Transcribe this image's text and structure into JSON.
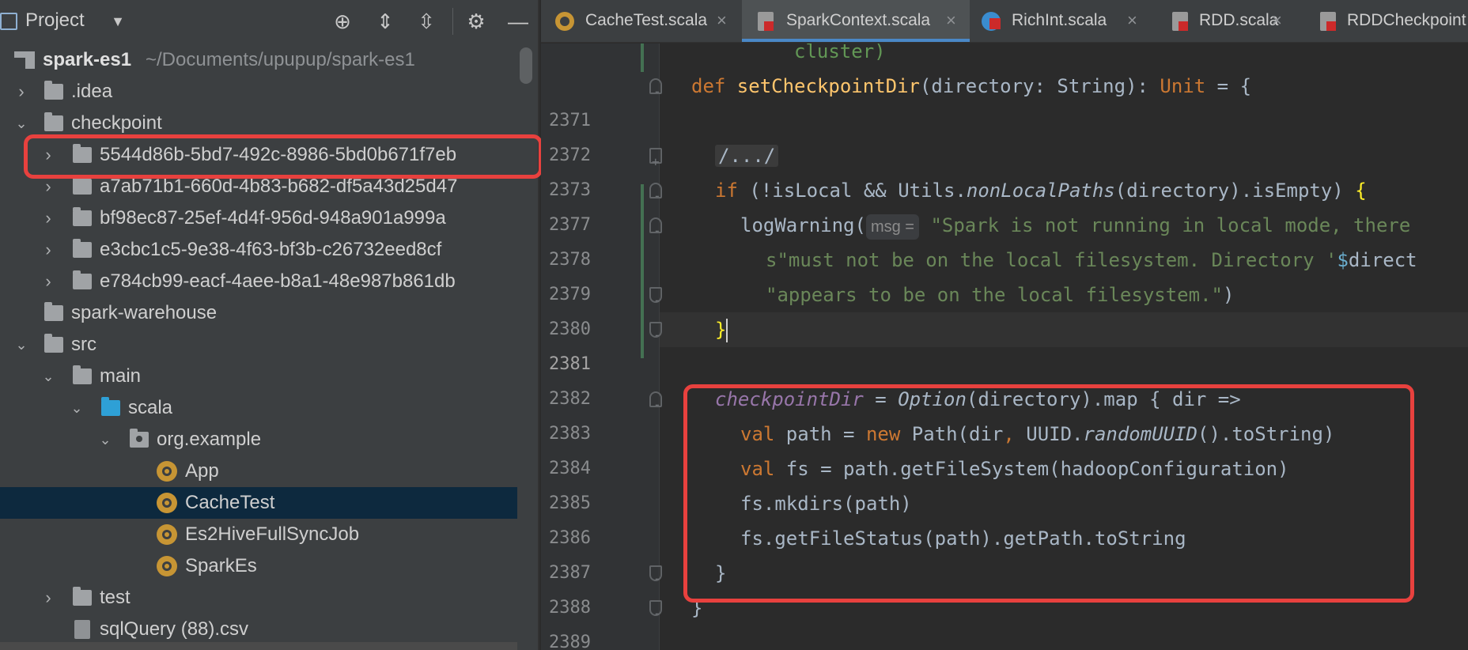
{
  "project_panel": {
    "title": "Project",
    "tree": [
      {
        "label": "spark-es1",
        "path": "~/Documents/upupup/spark-es1"
      },
      {
        "label": ".idea"
      },
      {
        "label": "checkpoint"
      },
      {
        "label": "5544d86b-5bd7-492c-8986-5bd0b671f7eb"
      },
      {
        "label": "a7ab71b1-660d-4b83-b682-df5a43d25d47"
      },
      {
        "label": "bf98ec87-25ef-4d4f-956d-948a901a999a"
      },
      {
        "label": "e3cbc1c5-9e38-4f63-bf3b-c26732eed8cf"
      },
      {
        "label": "e784cb99-eacf-4aee-b8a1-48e987b861db"
      },
      {
        "label": "spark-warehouse"
      },
      {
        "label": "src"
      },
      {
        "label": "main"
      },
      {
        "label": "scala"
      },
      {
        "label": "org.example"
      },
      {
        "label": "App"
      },
      {
        "label": "CacheTest"
      },
      {
        "label": "Es2HiveFullSyncJob"
      },
      {
        "label": "SparkEs"
      },
      {
        "label": "test"
      },
      {
        "label": "sqlQuery (88).csv"
      }
    ]
  },
  "tabs": [
    {
      "label": "CacheTest.scala",
      "close": "×"
    },
    {
      "label": "SparkContext.scala",
      "close": "×"
    },
    {
      "label": "RichInt.scala",
      "close": "×"
    },
    {
      "label": "RDD.scala",
      "close": "×"
    },
    {
      "label": "RDDCheckpoint"
    }
  ],
  "editor": {
    "line_numbers": [
      "",
      "2371",
      "2372",
      "2373",
      "2377",
      "2378",
      "2379",
      "2380",
      "2381",
      "2382",
      "2383",
      "2384",
      "2385",
      "2386",
      "2387",
      "2388",
      "2389"
    ],
    "lines": {
      "l0": "cluster)",
      "l1_def": "def ",
      "l1_fn": "setCheckpointDir",
      "l1_a": "(directory: String): ",
      "l1_unit": "Unit",
      "l1_b": " = {",
      "l3": "/.../",
      "l4_if": "if ",
      "l4_a": "(!isLocal && Utils.",
      "l4_ital": "nonLocalPaths",
      "l4_b": "(directory).isEmpty) ",
      "l4_brace": "{",
      "l5_a": "logWarning(",
      "l5_hint": "msg =",
      "l5_str": "\"Spark is not running in local mode, there",
      "l6_str": "s\"must not be on the local filesystem. Directory '",
      "l6_dollar": "$",
      "l6_b": "direct",
      "l7_str": "\"appears to be on the local filesystem.\"",
      "l7_b": ")",
      "l8_brace": "}",
      "l10_field": "checkpointDir",
      "l10_a": " = ",
      "l10_opt": "Option",
      "l10_b": "(directory).map { dir =>",
      "l11_val": "val ",
      "l11_a": "path = ",
      "l11_new": "new ",
      "l11_b": "Path(dir",
      "l11_comma": ", ",
      "l11_c": "UUID.",
      "l11_ital": "randomUUID",
      "l11_d": "().toString)",
      "l12_val": "val ",
      "l12_a": "fs = path.getFileSystem(hadoopConfiguration)",
      "l13": "fs.mkdirs(path)",
      "l14": "fs.getFileStatus(path).getPath.toString",
      "l15": "}",
      "l16": "}"
    }
  },
  "colors": {
    "highlight_box": "#e8413e",
    "selection": "#0d293e",
    "accent_tab": "#4a88c7"
  },
  "icons": [
    "project-icon",
    "dropdown-icon",
    "locate-icon",
    "expand-all-icon",
    "collapse-all-icon",
    "gear-icon",
    "minimize-icon",
    "folder-icon",
    "scala-object-icon",
    "csv-file-icon",
    "scala-class-icon"
  ]
}
